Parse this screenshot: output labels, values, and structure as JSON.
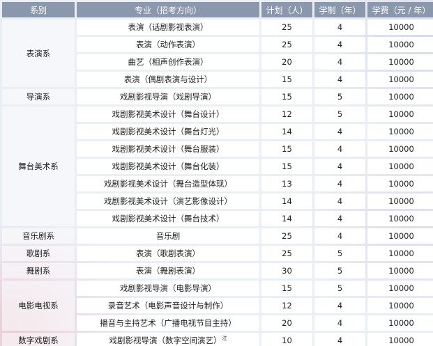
{
  "header": {
    "dept": "系别",
    "major": "专业（招考方向）",
    "plan": "计划（人）",
    "years": "学制（年）",
    "fee": "学费（元 / 年）"
  },
  "rows": [
    {
      "dept": "表演系",
      "span": 4,
      "major": "表演（话剧影视表演）",
      "plan": "25",
      "years": "4",
      "fee": "10000"
    },
    {
      "major": "表演（动作表演）",
      "plan": "25",
      "years": "4",
      "fee": "10000"
    },
    {
      "major": "曲艺（相声创作表演）",
      "plan": "20",
      "years": "4",
      "fee": "10000"
    },
    {
      "major": "表演（偶剧表演与设计）",
      "plan": "15",
      "years": "4",
      "fee": "10000"
    },
    {
      "dept": "导演系",
      "span": 1,
      "major": "戏剧影视导演（戏剧导演）",
      "plan": "15",
      "years": "5",
      "fee": "10000"
    },
    {
      "dept": "舞台美术系",
      "span": 7,
      "major": "戏剧影视美术设计（舞台设计）",
      "plan": "12",
      "years": "5",
      "fee": "10000"
    },
    {
      "major": "戏剧影视美术设计（舞台灯光）",
      "plan": "14",
      "years": "4",
      "fee": "10000"
    },
    {
      "major": "戏剧影视美术设计（舞台服装）",
      "plan": "15",
      "years": "4",
      "fee": "10000"
    },
    {
      "major": "戏剧影视美术设计（舞台化装）",
      "plan": "15",
      "years": "4",
      "fee": "10000"
    },
    {
      "major": "戏剧影视美术设计（舞台造型体现）",
      "plan": "13",
      "years": "4",
      "fee": "10000"
    },
    {
      "major": "戏剧影视美术设计（演艺影像设计）",
      "plan": "14",
      "years": "4",
      "fee": "10000"
    },
    {
      "major": "戏剧影视美术设计（舞台技术）",
      "plan": "14",
      "years": "4",
      "fee": "10000"
    },
    {
      "dept": "音乐剧系",
      "span": 1,
      "major": "音乐剧",
      "plan": "25",
      "years": "4",
      "fee": "10000"
    },
    {
      "dept": "歌剧系",
      "span": 1,
      "major": "表演（歌剧表演）",
      "plan": "25",
      "years": "5",
      "fee": "10000"
    },
    {
      "dept": "舞剧系",
      "span": 1,
      "major": "表演（舞剧表演）",
      "plan": "30",
      "years": "5",
      "fee": "10000"
    },
    {
      "dept": "电影电视系",
      "span": 3,
      "major": "戏剧影视导演（电影导演）",
      "plan": "15",
      "years": "5",
      "fee": "10000"
    },
    {
      "major": "录音艺术（电影声音设计与制作）",
      "plan": "12",
      "years": "4",
      "fee": "10000"
    },
    {
      "major": "播音与主持艺术（广播电视节目主持）",
      "plan": "20",
      "years": "4",
      "fee": "10000"
    },
    {
      "dept": "数字戏剧系",
      "span": 1,
      "major": "戏剧影视导演（数字空间演艺）",
      "note": "注",
      "plan": "10",
      "years": "4",
      "fee": "10000"
    }
  ]
}
